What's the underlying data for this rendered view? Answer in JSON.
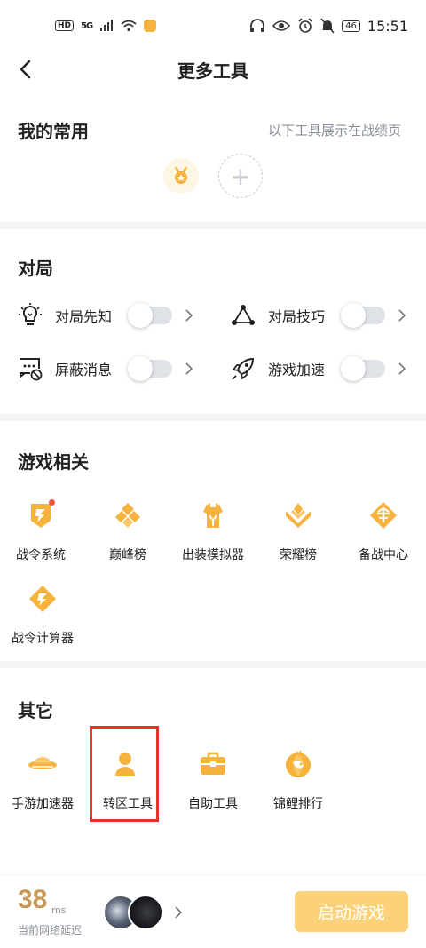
{
  "statusbar": {
    "hd": "HD",
    "signal": "5G",
    "battery": "46",
    "time": "15:51"
  },
  "header": {
    "title": "更多工具"
  },
  "favorites": {
    "title": "我的常用",
    "note": "以下工具展示在战绩页",
    "add_symbol": "+"
  },
  "game": {
    "title": "对局",
    "toggles": [
      {
        "label": "对局先知",
        "icon": "lightbulb-icon",
        "on": false
      },
      {
        "label": "对局技巧",
        "icon": "triangle-nodes-icon",
        "on": false
      },
      {
        "label": "屏蔽消息",
        "icon": "chat-block-icon",
        "on": false
      },
      {
        "label": "游戏加速",
        "icon": "rocket-icon",
        "on": false
      }
    ]
  },
  "related": {
    "title": "游戏相关",
    "items": [
      {
        "label": "战令系统",
        "icon": "battle-pass-icon",
        "badge": true
      },
      {
        "label": "巅峰榜",
        "icon": "peak-rank-icon"
      },
      {
        "label": "出装模拟器",
        "icon": "equipment-sim-icon"
      },
      {
        "label": "荣耀榜",
        "icon": "glory-rank-icon"
      },
      {
        "label": "备战中心",
        "icon": "prep-center-icon"
      },
      {
        "label": "战令计算器",
        "icon": "pass-calculator-icon"
      }
    ]
  },
  "others": {
    "title": "其它",
    "items": [
      {
        "label": "手游加速器",
        "icon": "accelerator-icon"
      },
      {
        "label": "转区工具",
        "icon": "transfer-icon"
      },
      {
        "label": "自助工具",
        "icon": "toolbox-icon"
      },
      {
        "label": "锦鲤排行",
        "icon": "koi-rank-icon"
      }
    ]
  },
  "bottombar": {
    "ping_value": "38",
    "ping_unit": "ms",
    "ping_label": "当前网络延迟",
    "start_label": "启动游戏"
  },
  "colors": {
    "accent": "#f5b33d",
    "button": "#fbd27a",
    "ping": "#c79a5a",
    "highlight": "#e8332b"
  }
}
